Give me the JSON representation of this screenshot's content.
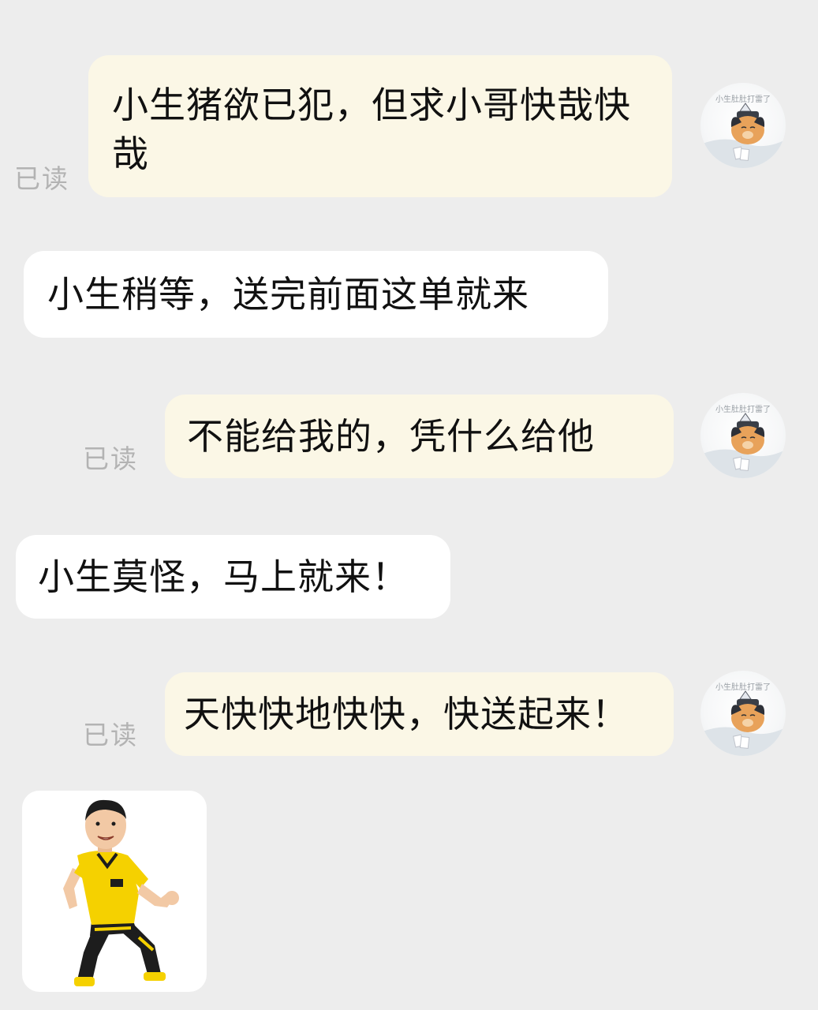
{
  "avatar_caption": "小生肚肚打雷了",
  "messages": [
    {
      "side": "out",
      "text": "小生猪欲已犯，但求小哥快哉快哉",
      "status": "已读"
    },
    {
      "side": "in",
      "text": "小生稍等，送完前面这单就来"
    },
    {
      "side": "out",
      "text": "不能给我的，凭什么给他",
      "status": "已读"
    },
    {
      "side": "in",
      "text": "小生莫怪，马上就来！"
    },
    {
      "side": "out",
      "text": "天快快地快快，快送起来！",
      "status": "已读"
    },
    {
      "side": "in",
      "type": "sticker",
      "sticker": "running-courier-sticker"
    }
  ],
  "colors": {
    "background": "#ededed",
    "outgoing_bubble": "#fbf7e6",
    "incoming_bubble": "#ffffff",
    "read_status": "#b3b3b3",
    "courier_uniform": "#f5d100"
  }
}
